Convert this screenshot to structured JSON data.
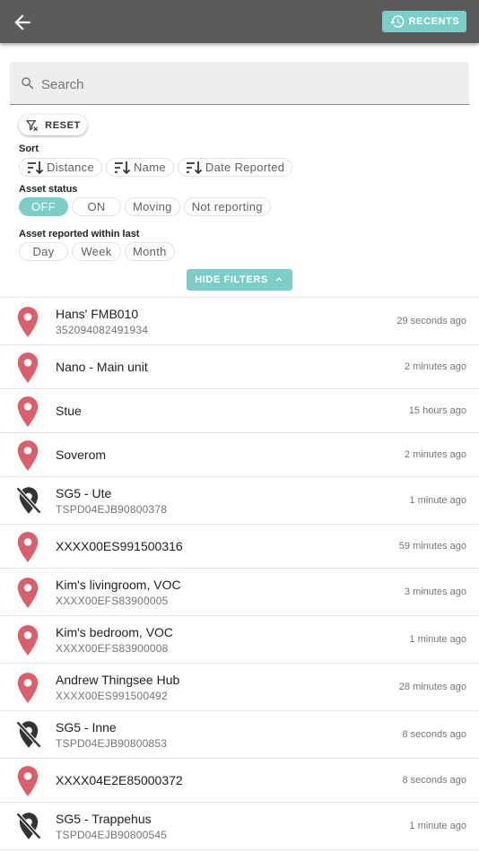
{
  "header": {
    "recents_label": "RECENTS"
  },
  "search": {
    "placeholder": "Search"
  },
  "filters": {
    "reset_label": "RESET",
    "sort_label": "Sort",
    "sort_options": [
      "Distance",
      "Name",
      "Date Reported"
    ],
    "status_label": "Asset status",
    "status_options": [
      "OFF",
      "ON",
      "Moving",
      "Not reporting"
    ],
    "status_selected": "OFF",
    "period_label": "Asset reported within last",
    "period_options": [
      "Day",
      "Week",
      "Month"
    ],
    "hide_label": "HIDE FILTERS"
  },
  "colors": {
    "accent": "#7ccdc5",
    "pin": "#d9606a",
    "offline": "#333333",
    "header": "#5b5b5b"
  },
  "assets": [
    {
      "name": "Hans' FMB010",
      "id": "352094082491934",
      "time": "29 seconds ago",
      "icon": "location-pin-icon"
    },
    {
      "name": "Nano - Main unit",
      "id": "",
      "time": "2 minutes ago",
      "icon": "location-pin-icon"
    },
    {
      "name": "Stue",
      "id": "",
      "time": "15 hours ago",
      "icon": "location-pin-icon"
    },
    {
      "name": "Soverom",
      "id": "",
      "time": "2 minutes ago",
      "icon": "location-pin-icon"
    },
    {
      "name": "SG5 - Ute",
      "id": "TSPD04EJB90800378",
      "time": "1 minute ago",
      "icon": "location-off-icon"
    },
    {
      "name": "XXXX00ES991500316",
      "id": "",
      "time": "59 minutes ago",
      "icon": "location-pin-icon"
    },
    {
      "name": "Kim's livingroom, VOC",
      "id": "XXXX00EFS83900005",
      "time": "3 minutes ago",
      "icon": "location-pin-icon"
    },
    {
      "name": "Kim's bedroom, VOC",
      "id": "XXXX00EFS83900008",
      "time": "1 minute ago",
      "icon": "location-pin-icon"
    },
    {
      "name": "Andrew Thingsee Hub",
      "id": "XXXX00ES991500492",
      "time": "28 minutes ago",
      "icon": "location-pin-icon"
    },
    {
      "name": "SG5 - Inne",
      "id": "TSPD04EJB90800853",
      "time": "8 seconds ago",
      "icon": "location-off-icon"
    },
    {
      "name": "XXXX04E2E85000372",
      "id": "",
      "time": "8 seconds ago",
      "icon": "location-pin-icon"
    },
    {
      "name": "SG5 - Trappehus",
      "id": "TSPD04EJB90800545",
      "time": "1 minute ago",
      "icon": "location-off-icon"
    }
  ]
}
